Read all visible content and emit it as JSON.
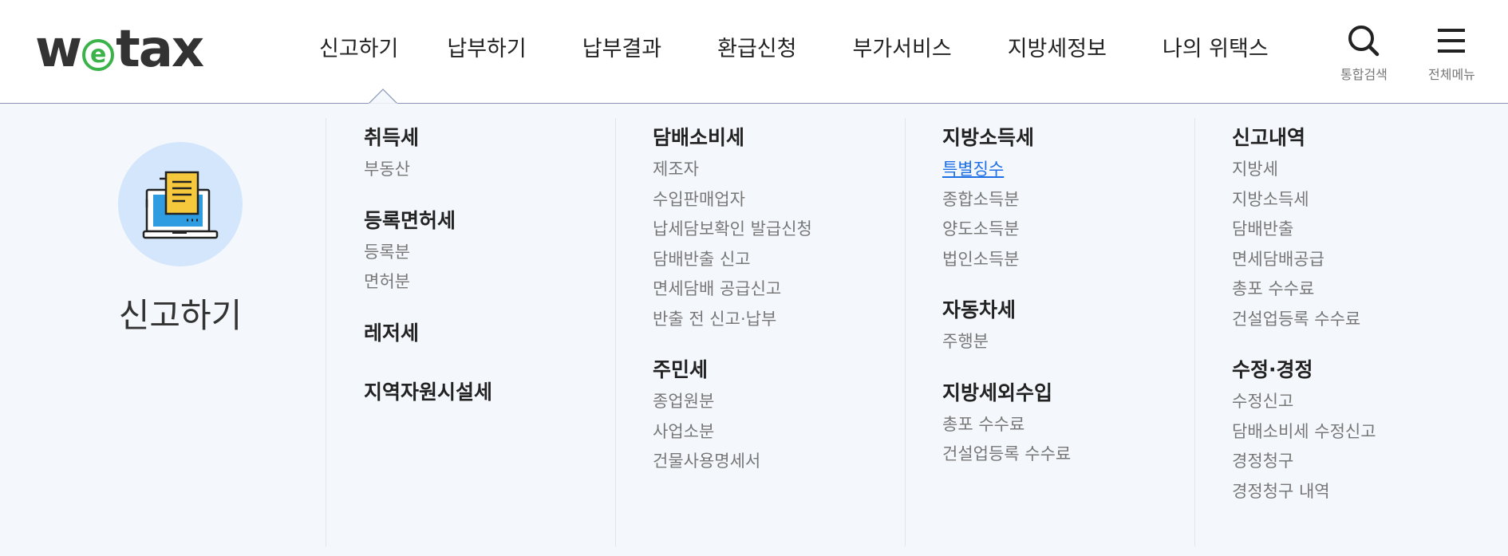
{
  "header": {
    "logo": {
      "pre": "w",
      "mid": "e",
      "post": "tax"
    },
    "nav": [
      {
        "label": "신고하기"
      },
      {
        "label": "납부하기"
      },
      {
        "label": "납부결과"
      },
      {
        "label": "환급신청"
      },
      {
        "label": "부가서비스"
      },
      {
        "label": "지방세정보"
      },
      {
        "label": "나의 위택스"
      }
    ],
    "search_label": "통합검색",
    "menu_label": "전체메뉴"
  },
  "mega": {
    "title": "신고하기",
    "columns": [
      {
        "groups": [
          {
            "title": "취득세",
            "items": [
              "부동산"
            ]
          },
          {
            "title": "등록면허세",
            "items": [
              "등록분",
              "면허분"
            ]
          },
          {
            "title": "레저세",
            "items": []
          },
          {
            "title": "지역자원시설세",
            "items": []
          }
        ]
      },
      {
        "groups": [
          {
            "title": "담배소비세",
            "items": [
              "제조자",
              "수입판매업자",
              "납세담보확인 발급신청",
              "담배반출 신고",
              "면세담배 공급신고",
              "반출 전 신고·납부"
            ]
          },
          {
            "title": "주민세",
            "items": [
              "종업원분",
              "사업소분",
              "건물사용명세서"
            ]
          }
        ]
      },
      {
        "groups": [
          {
            "title": "지방소득세",
            "items": [
              "특별징수",
              "종합소득분",
              "양도소득분",
              "법인소득분"
            ]
          },
          {
            "title": "자동차세",
            "items": [
              "주행분"
            ]
          },
          {
            "title": "지방세외수입",
            "items": [
              "총포 수수료",
              "건설업등록 수수료"
            ]
          }
        ]
      },
      {
        "groups": [
          {
            "title": "신고내역",
            "items": [
              "지방세",
              "지방소득세",
              "담배반출",
              "면세담배공급",
              "총포 수수료",
              "건설업등록 수수료"
            ]
          },
          {
            "title": "수정·경정",
            "items": [
              "수정신고",
              "담배소비세 수정신고",
              "경정청구",
              "경정청구 내역"
            ]
          }
        ]
      }
    ]
  },
  "colors": {
    "accent_green": "#3bb34a",
    "link_blue": "#1d6fe6",
    "panel_bg": "#f4f8fc",
    "intro_circle": "#d3e6fb"
  }
}
